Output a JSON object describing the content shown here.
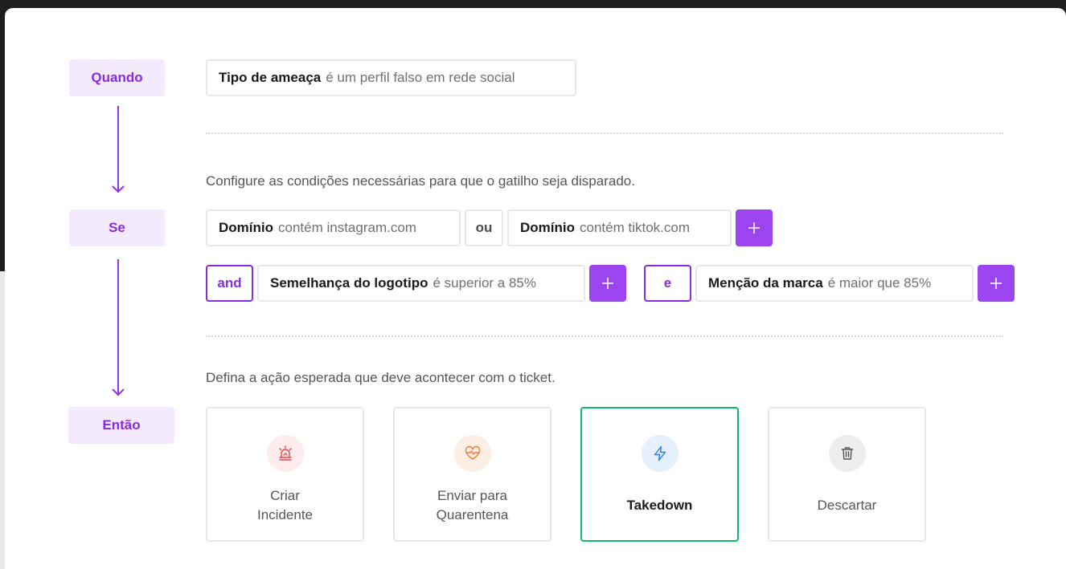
{
  "steps": {
    "when": "Quando",
    "if": "Se",
    "then": "Então"
  },
  "trigger": {
    "field": "Tipo de ameaça",
    "text": "é um perfil falso em rede social"
  },
  "conditions_hint": "Configure as condições necessárias para que o gatilho seja disparado.",
  "condition_row1": {
    "cond1": {
      "field": "Domínio",
      "text": "contém instagram.com"
    },
    "operator": "ou",
    "cond2": {
      "field": "Domínio",
      "text": "contém tiktok.com"
    },
    "add": "+"
  },
  "condition_row2": {
    "group1": {
      "operator": "and",
      "cond": {
        "field": "Semelhança do logotipo",
        "text": "é superior a 85%"
      },
      "add": "+"
    },
    "group2": {
      "operator": "e",
      "cond": {
        "field": "Menção da marca",
        "text": "é maior que 85%"
      },
      "add": "+"
    }
  },
  "actions_hint": "Defina a ação esperada que deve acontecer com o ticket.",
  "actions": [
    {
      "label": "Criar\nIncidente",
      "icon": "alarm-siren-icon",
      "icon_bg": "#fdeceb",
      "icon_color": "#e5484d",
      "selected": false
    },
    {
      "label": "Enviar para\nQuarentena",
      "icon": "heart-pulse-icon",
      "icon_bg": "#fdeee4",
      "icon_color": "#f07a3a",
      "selected": false
    },
    {
      "label": "Takedown",
      "icon": "lightning-icon",
      "icon_bg": "#e6f0fd",
      "icon_color": "#2e7be4",
      "selected": true
    },
    {
      "label": "Descartar",
      "icon": "trash-icon",
      "icon_bg": "#ededee",
      "icon_color": "#55555a",
      "selected": false
    }
  ],
  "colors": {
    "accent_purple": "#8a2be2",
    "selected_green": "#12b76a",
    "step_bg": "#f3eafe"
  }
}
